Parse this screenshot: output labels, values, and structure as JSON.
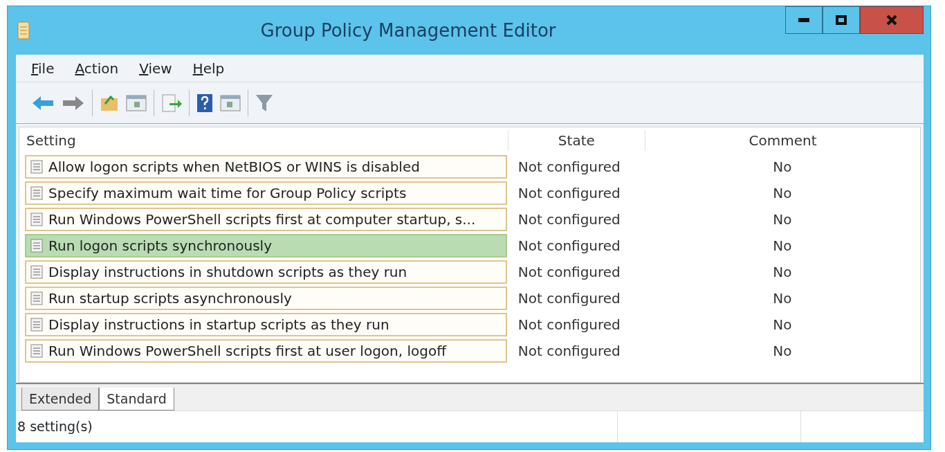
{
  "window": {
    "title": "Group Policy Management Editor"
  },
  "menu": [
    "File",
    "Action",
    "View",
    "Help"
  ],
  "table": {
    "columns": [
      "Setting",
      "State",
      "Comment"
    ],
    "rows": [
      {
        "setting": "Allow logon scripts when NetBIOS or WINS is disabled",
        "state": "Not configured",
        "comment": "No",
        "selected": false
      },
      {
        "setting": "Specify maximum wait time for Group Policy scripts",
        "state": "Not configured",
        "comment": "No",
        "selected": false
      },
      {
        "setting": "Run Windows PowerShell scripts first at computer startup, s...",
        "state": "Not configured",
        "comment": "No",
        "selected": false
      },
      {
        "setting": "Run logon scripts synchronously",
        "state": "Not configured",
        "comment": "No",
        "selected": true
      },
      {
        "setting": "Display instructions in shutdown scripts as they run",
        "state": "Not configured",
        "comment": "No",
        "selected": false
      },
      {
        "setting": "Run startup scripts asynchronously",
        "state": "Not configured",
        "comment": "No",
        "selected": false
      },
      {
        "setting": "Display instructions in startup scripts as they run",
        "state": "Not configured",
        "comment": "No",
        "selected": false
      },
      {
        "setting": "Run Windows PowerShell scripts first at user logon, logoff",
        "state": "Not configured",
        "comment": "No",
        "selected": false
      }
    ]
  },
  "tabs": [
    {
      "label": "Extended",
      "selected": false
    },
    {
      "label": "Standard",
      "selected": true
    }
  ],
  "status_bar": {
    "text": "8 setting(s)"
  }
}
